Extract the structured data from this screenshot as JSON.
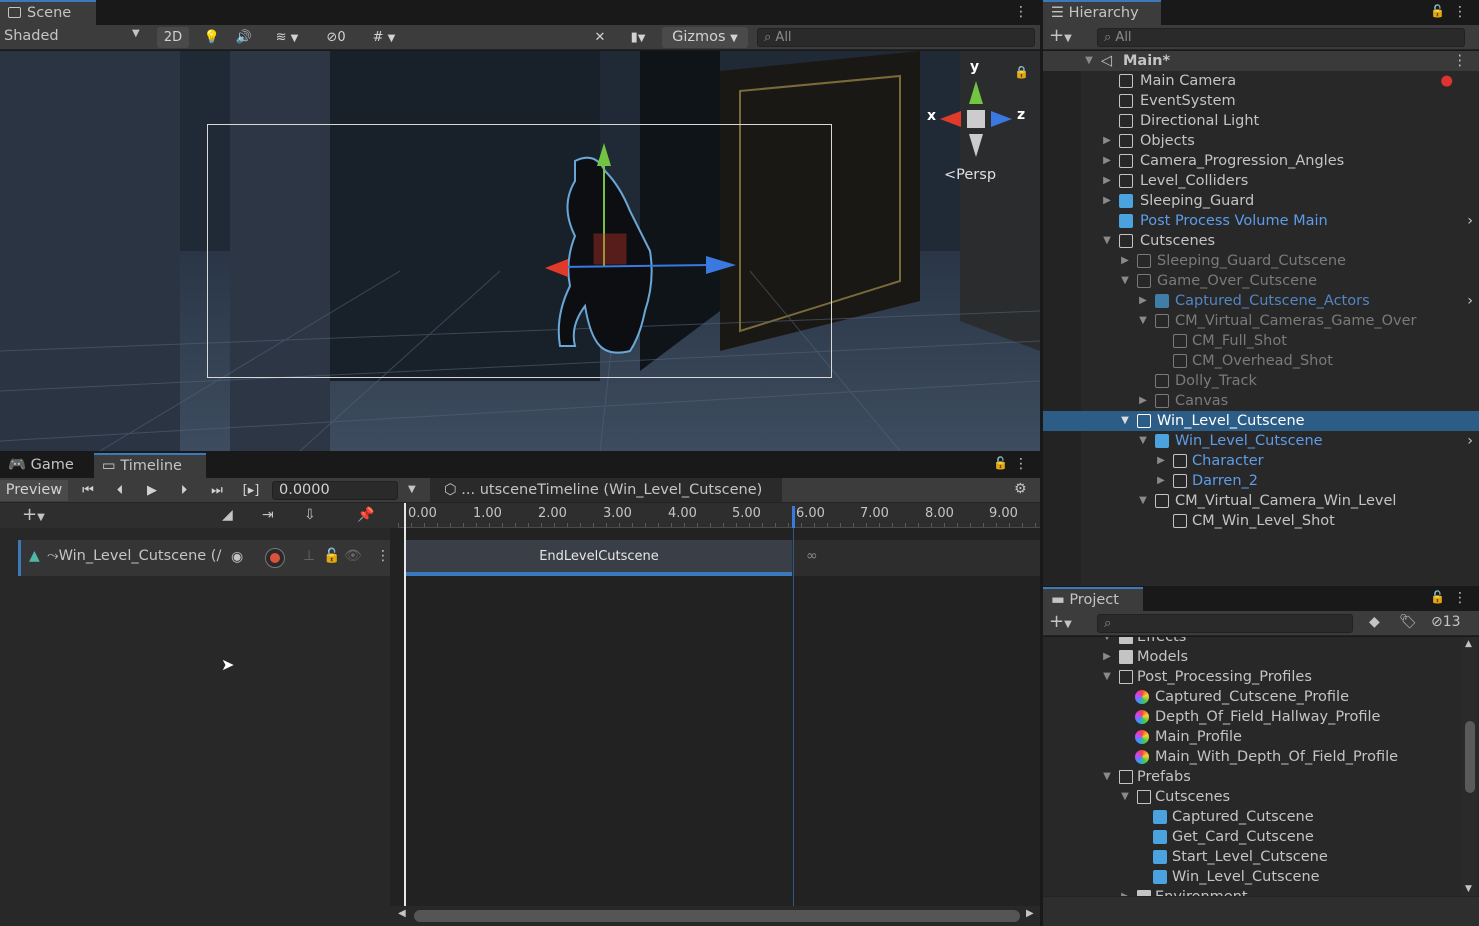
{
  "scene": {
    "tab": "Scene",
    "shading": "Shaded",
    "mode2d": "2D",
    "hidden_count": "0",
    "gizmos": "Gizmos",
    "search_placeholder": "All",
    "persp": "Persp",
    "axis_x": "x",
    "axis_y": "y",
    "axis_z": "z"
  },
  "game_tab": "Game",
  "timeline": {
    "tab": "Timeline",
    "preview": "Preview",
    "time": "0.0000",
    "asset": "... utsceneTimeline (Win_Level_Cutscene)",
    "track_name": "Win_Level_Cutscene (/",
    "clip": "EndLevelCutscene",
    "ruler": [
      "0.00",
      "1.00",
      "2.00",
      "3.00",
      "4.00",
      "5.00",
      "6.00",
      "7.00",
      "8.00",
      "9.00"
    ]
  },
  "hierarchy": {
    "tab": "Hierarchy",
    "search_placeholder": "All",
    "scene": "Main*",
    "items": [
      "Main Camera",
      "EventSystem",
      "Directional Light",
      "Objects",
      "Camera_Progression_Angles",
      "Level_Colliders",
      "Sleeping_Guard",
      "Post Process Volume Main",
      "Cutscenes",
      "Sleeping_Guard_Cutscene",
      "Game_Over_Cutscene",
      "Captured_Cutscene_Actors",
      "CM_Virtual_Cameras_Game_Over",
      "CM_Full_Shot",
      "CM_Overhead_Shot",
      "Dolly_Track",
      "Canvas",
      "Win_Level_Cutscene",
      "Win_Level_Cutscene",
      "Character",
      "Darren_2",
      "CM_Virtual_Camera_Win_Level",
      "CM_Win_Level_Shot"
    ]
  },
  "project": {
    "tab": "Project",
    "hidden_count": "13",
    "items": [
      "Effects",
      "Models",
      "Post_Processing_Profiles",
      "Captured_Cutscene_Profile",
      "Depth_Of_Field_Hallway_Profile",
      "Main_Profile",
      "Main_With_Depth_Of_Field_Profile",
      "Prefabs",
      "Cutscenes",
      "Captured_Cutscene",
      "Get_Card_Cutscene",
      "Start_Level_Cutscene",
      "Win_Level_Cutscene",
      "Environment"
    ]
  },
  "colors": {
    "accent": "#3a79bb",
    "selection": "#2c5d87",
    "prefab_blue": "#5e9cea",
    "clip": "#3a3f47"
  }
}
